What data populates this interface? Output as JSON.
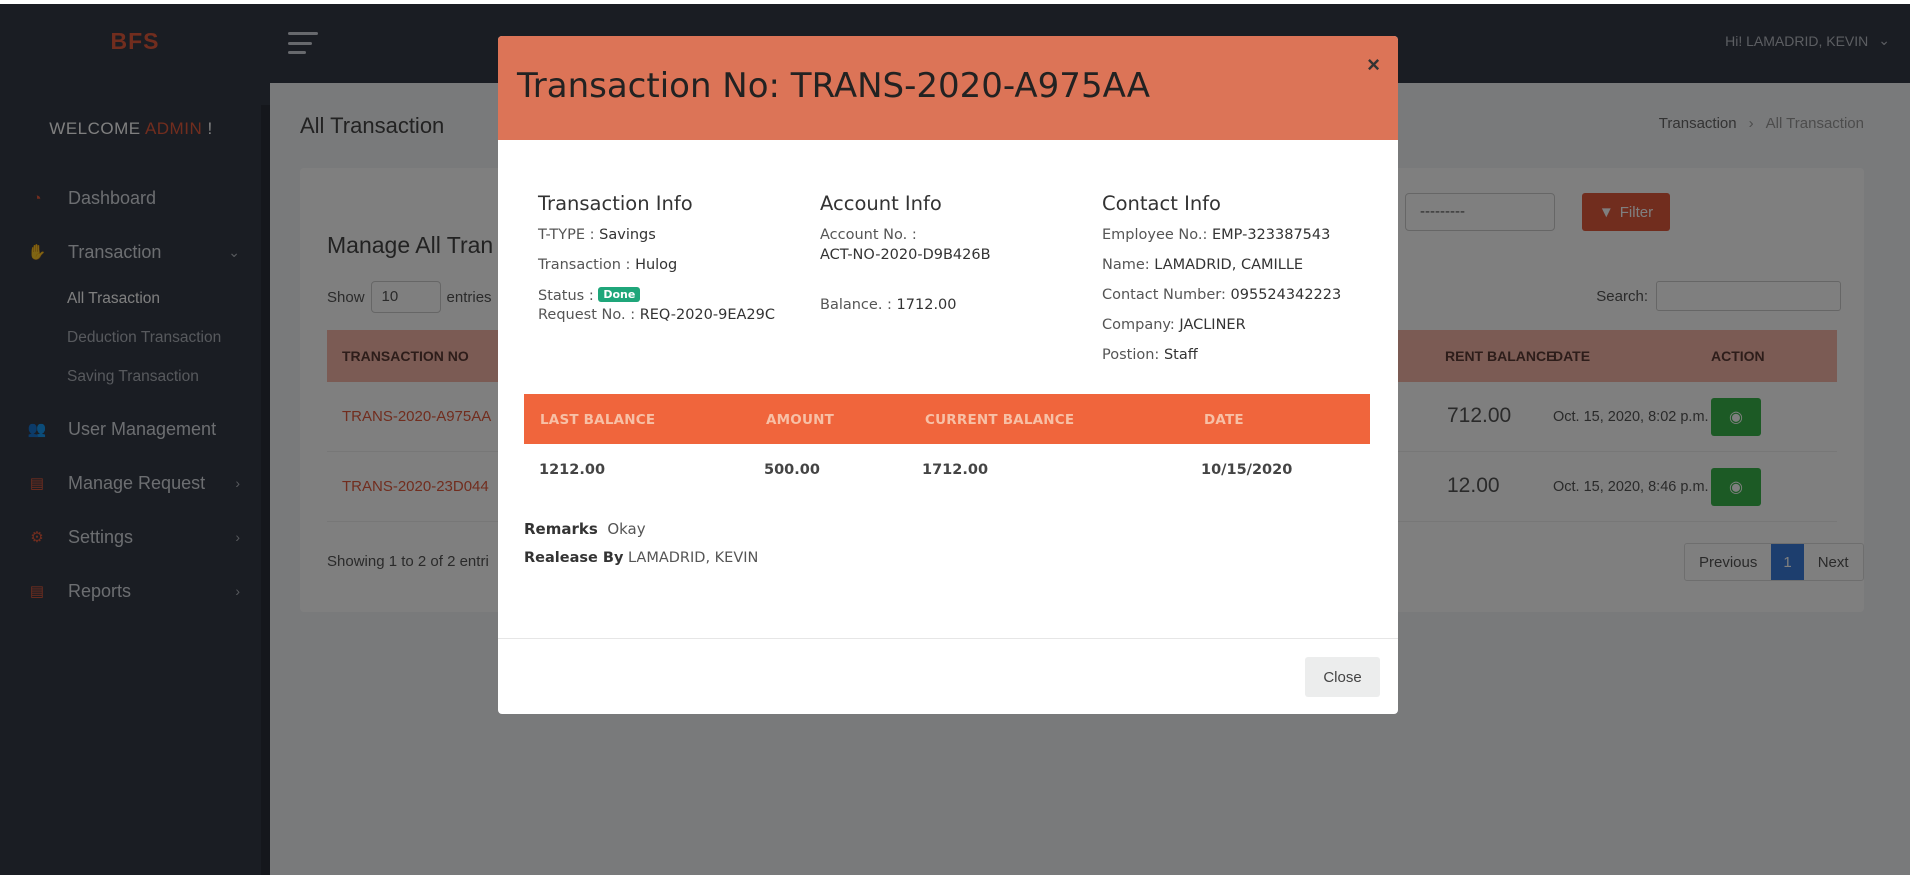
{
  "app": {
    "brand": "BFS",
    "user_greeting": "Hi! LAMADRID, KEVIN"
  },
  "sidebar": {
    "welcome_prefix": "WELCOME",
    "welcome_role": "ADMIN",
    "welcome_suffix": "!",
    "items": [
      {
        "label": "Dashboard",
        "icon": "dashboard-icon"
      },
      {
        "label": "Transaction",
        "icon": "handshake-icon",
        "expanded": true,
        "subitems": [
          {
            "label": "All Trasaction",
            "active": true
          },
          {
            "label": "Deduction Transaction"
          },
          {
            "label": "Saving Transaction"
          }
        ]
      },
      {
        "label": "User Management",
        "icon": "users-icon"
      },
      {
        "label": "Manage Request",
        "icon": "document-icon"
      },
      {
        "label": "Settings",
        "icon": "gear-icon"
      },
      {
        "label": "Reports",
        "icon": "report-icon"
      }
    ]
  },
  "page": {
    "title": "All Transaction",
    "breadcrumb": [
      "Transaction",
      "All Transaction"
    ],
    "card_title": "Manage All Tran",
    "filter_select_value": "---------",
    "filter_label": "Filter",
    "show_label": "Show",
    "show_value": "10",
    "entries_label": "entries",
    "search_label": "Search:",
    "columns": [
      "TRANSACTION NO",
      "RENT BALANCE",
      "DATE",
      "ACTION"
    ],
    "rows": [
      {
        "trans_no": "TRANS-2020-A975AA",
        "balance": "712.00",
        "date": "Oct. 15, 2020, 8:02 p.m."
      },
      {
        "trans_no": "TRANS-2020-23D044",
        "balance": "12.00",
        "date": "Oct. 15, 2020, 8:46 p.m."
      }
    ],
    "showing": "Showing 1 to 2 of 2 entri",
    "pager": {
      "previous": "Previous",
      "current": "1",
      "next": "Next"
    }
  },
  "modal": {
    "title": "Transaction No: TRANS-2020-A975AA",
    "close_x": "×",
    "transaction_info": {
      "heading": "Transaction Info",
      "ttype_label": "T-TYPE :",
      "ttype": "Savings",
      "transaction_label": "Transaction :",
      "transaction": "Hulog",
      "status_label": "Status :",
      "status": "Done",
      "request_label": "Request No. :",
      "request": "REQ-2020-9EA29C"
    },
    "account_info": {
      "heading": "Account Info",
      "account_label": "Account No. :",
      "account": "ACT-NO-2020-D9B426B",
      "balance_label": "Balance. :",
      "balance": "1712.00"
    },
    "contact_info": {
      "heading": "Contact Info",
      "employee_label": "Employee No.:",
      "employee": "EMP-323387543",
      "name_label": "Name:",
      "name": "LAMADRID, CAMILLE",
      "contact_label": "Contact Number:",
      "contact": "095524342223",
      "company_label": "Company:",
      "company": "JACLINER",
      "position_label": "Postion:",
      "position": "Staff"
    },
    "table": {
      "headers": [
        "LAST BALANCE",
        "AMOUNT",
        "CURRENT BALANCE",
        "DATE"
      ],
      "row": [
        "1212.00",
        "500.00",
        "1712.00",
        "10/15/2020"
      ]
    },
    "remarks_label": "Remarks",
    "remarks": "Okay",
    "release_label": "Realease By",
    "release": "LAMADRID, KEVIN",
    "close_button": "Close"
  },
  "colors": {
    "accent": "#e35a3d",
    "modal_header": "#dc7457",
    "table_header": "#f0653c",
    "success": "#1fa67a"
  }
}
